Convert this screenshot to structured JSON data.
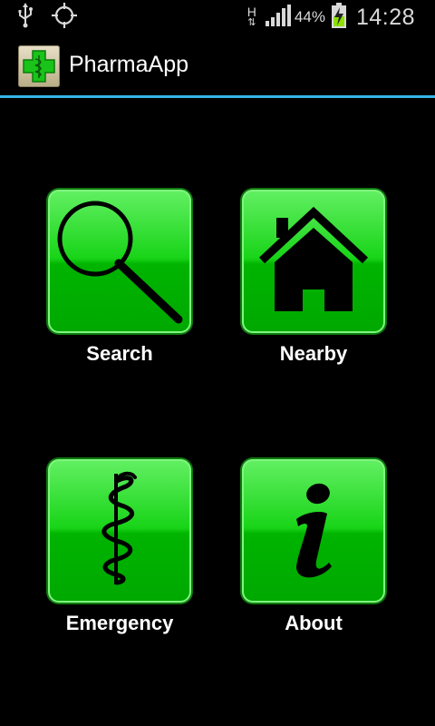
{
  "status_bar": {
    "network_letter": "H",
    "network_arrows": "⇅",
    "battery_percent": "44%",
    "time": "14:28",
    "icons": [
      "usb-icon",
      "gps-icon",
      "signal-icon",
      "battery-charging-icon"
    ]
  },
  "action_bar": {
    "app_title": "PharmaApp",
    "app_icon": "pharmacy-cross-icon",
    "divider_color": "#33b5e5"
  },
  "menu": {
    "tiles": [
      {
        "label": "Search",
        "icon": "magnifier-icon"
      },
      {
        "label": "Nearby",
        "icon": "house-icon"
      },
      {
        "label": "Emergency",
        "icon": "caduceus-icon"
      },
      {
        "label": "About",
        "icon": "info-icon"
      }
    ],
    "tile_color": "#12cc12"
  }
}
